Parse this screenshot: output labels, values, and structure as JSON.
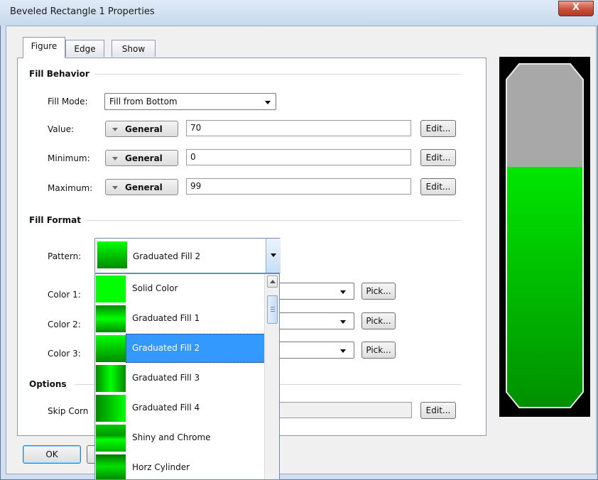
{
  "window": {
    "title": "Beveled Rectangle 1 Properties",
    "close_glyph": "X"
  },
  "tabs": [
    {
      "label": "Figure",
      "active": true
    },
    {
      "label": "Edge",
      "active": false
    },
    {
      "label": "Show",
      "active": false
    }
  ],
  "fill_behavior": {
    "heading": "Fill Behavior",
    "fill_mode_label": "Fill Mode:",
    "fill_mode_value": "Fill from Bottom",
    "rows": [
      {
        "label": "Value:",
        "format": "General",
        "value": "70",
        "edit": "Edit..."
      },
      {
        "label": "Minimum:",
        "format": "General",
        "value": "0",
        "edit": "Edit..."
      },
      {
        "label": "Maximum:",
        "format": "General",
        "value": "99",
        "edit": "Edit..."
      }
    ]
  },
  "fill_format": {
    "heading": "Fill Format",
    "pattern_label": "Pattern:",
    "pattern_value": "Graduated Fill 2",
    "colors": [
      {
        "label": "Color 1:",
        "pick": "Pick..."
      },
      {
        "label": "Color 2:",
        "pick": "Pick..."
      },
      {
        "label": "Color 3:",
        "pick": "Pick..."
      }
    ]
  },
  "options": {
    "heading": "Options",
    "skip_label": "Skip Corn",
    "edit": "Edit..."
  },
  "footer": {
    "ok": "OK"
  },
  "dropdown": {
    "items": [
      {
        "label": "Solid Color",
        "selected": false
      },
      {
        "label": "Graduated Fill 1",
        "selected": false
      },
      {
        "label": "Graduated Fill 2",
        "selected": true
      },
      {
        "label": "Graduated Fill 3",
        "selected": false
      },
      {
        "label": "Graduated Fill 4",
        "selected": false
      },
      {
        "label": "Shiny and Chrome",
        "selected": false
      },
      {
        "label": "Horz Cylinder",
        "selected": false
      }
    ]
  },
  "preview": {
    "fill_fraction": 0.7
  },
  "colors": {
    "accent_selection": "#3399ff",
    "fill_green": "#00cc00",
    "empty_gray": "#a8a8a8"
  }
}
